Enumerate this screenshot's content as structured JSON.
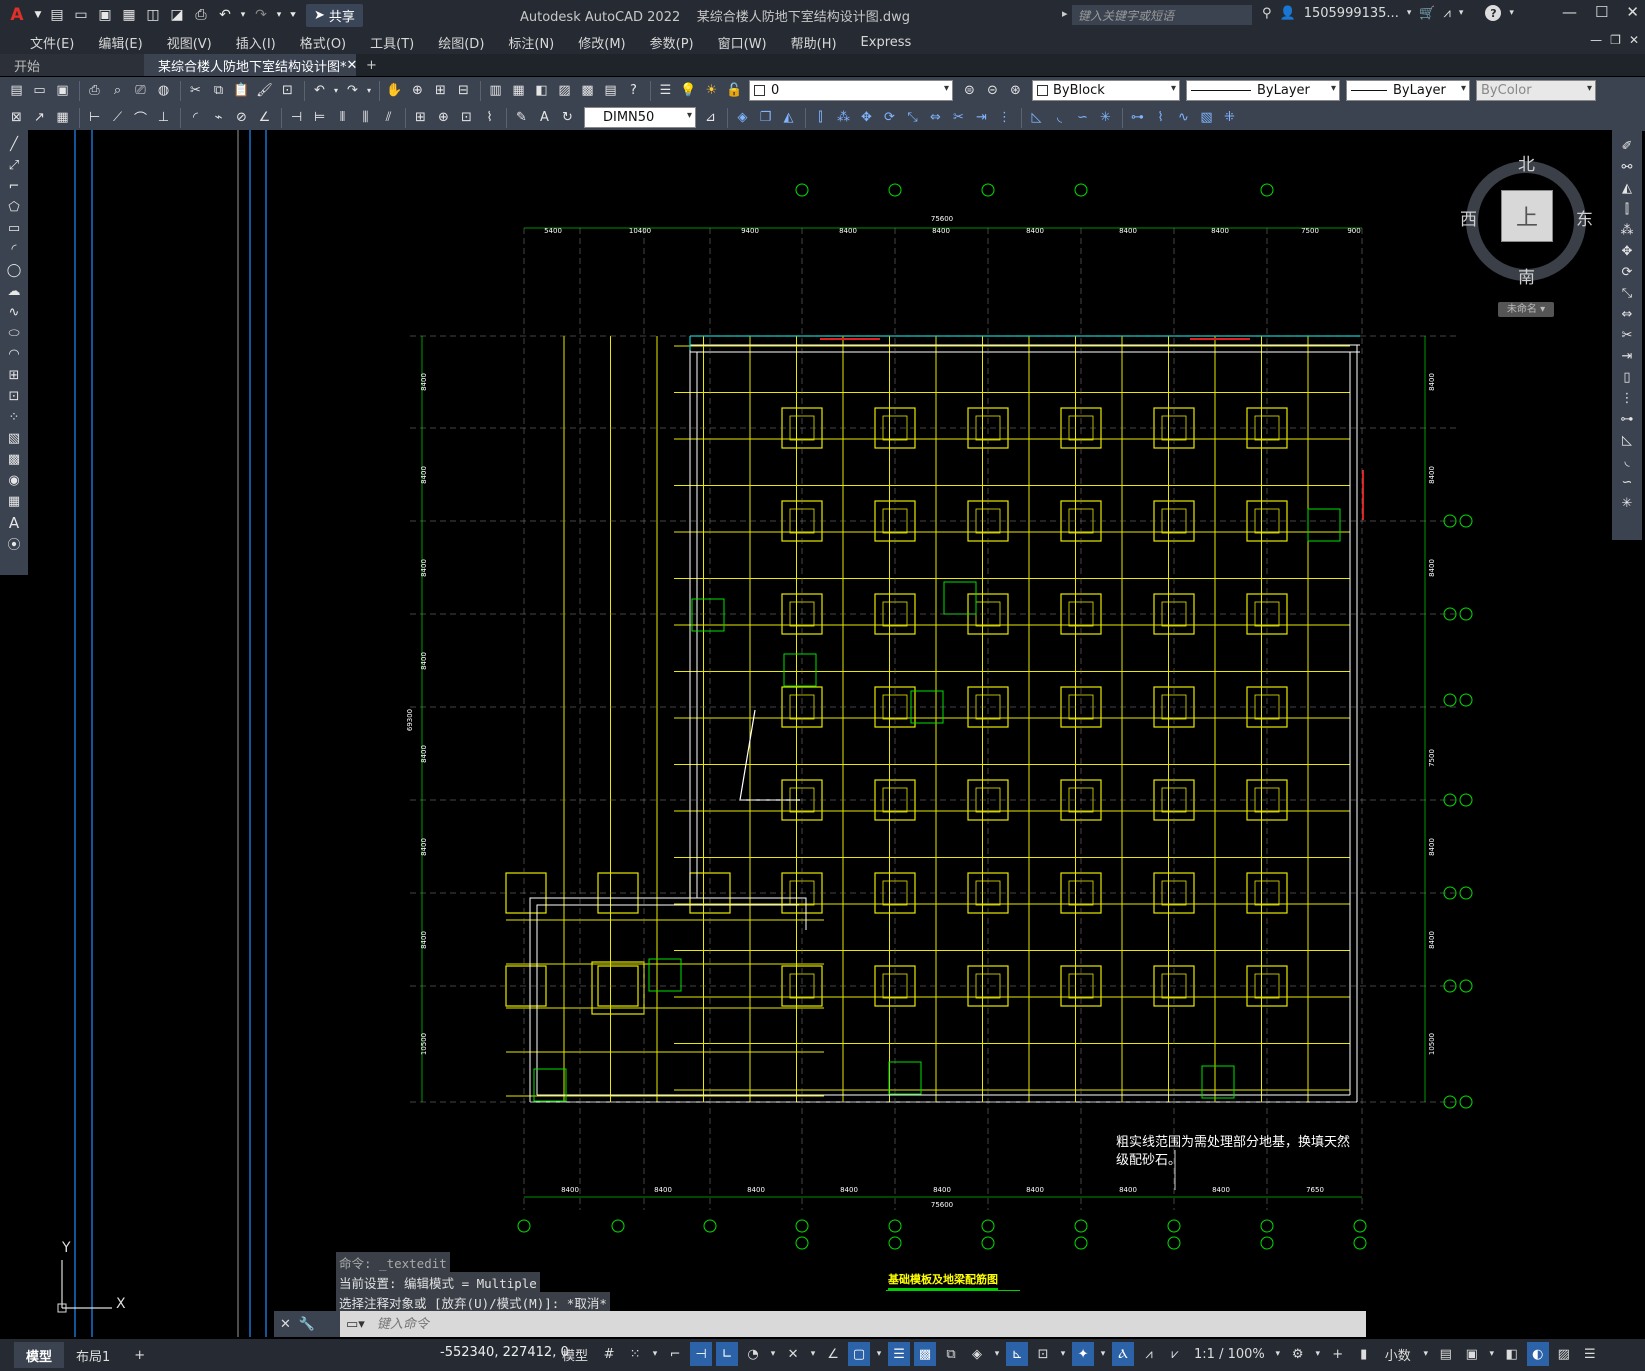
{
  "title": {
    "app": "Autodesk AutoCAD 2022",
    "file": "某综合楼人防地下室结构设计图.dwg",
    "share_label": "共享",
    "search_placeholder": "键入关键字或短语",
    "user": "1505999135...",
    "help": "?"
  },
  "menu": [
    "文件(E)",
    "编辑(E)",
    "视图(V)",
    "插入(I)",
    "格式(O)",
    "工具(T)",
    "绘图(D)",
    "标注(N)",
    "修改(M)",
    "参数(P)",
    "窗口(W)",
    "帮助(H)",
    "Express"
  ],
  "tabs": {
    "start": "开始",
    "active": "某综合楼人防地下室结构设计图*",
    "close": "✕",
    "plus": "+"
  },
  "toolbar": {
    "layer": "0",
    "color": "ByBlock",
    "linetype": "ByLayer",
    "lineweight": "ByLayer",
    "plotstyle": "ByColor",
    "dimstyle": "DIMN50"
  },
  "viewcube": {
    "north": "北",
    "south": "南",
    "east": "东",
    "west": "西",
    "face": "上",
    "wcs": "未命名 ▾"
  },
  "drawing": {
    "total_top": "75600",
    "total_bottom": "75600",
    "total_left": "69300",
    "top_dims": [
      "5400",
      "10400",
      "9400",
      "8400",
      "8400",
      "8400",
      "8400",
      "8400",
      "7500",
      "900"
    ],
    "bottom_dims": [
      "8400",
      "8400",
      "8400",
      "8400",
      "8400",
      "8400",
      "8400",
      "8400",
      "7650"
    ],
    "left_dims": [
      "8400",
      "8400",
      "8400",
      "8400",
      "8400",
      "8400",
      "8400",
      "10500"
    ],
    "right_dims": [
      "8400",
      "8400",
      "8400",
      "7500",
      "8400",
      "8400",
      "10500"
    ],
    "note_line1": "粗实线范围为需处理部分地基，换填天然",
    "note_line2": "级配砂石。",
    "drawing_title": "基础模板及地梁配筋图"
  },
  "command": {
    "history": [
      "命令: _textedit",
      "当前设置: 编辑模式 = Multiple",
      "选择注释对象或 [放弃(U)/模式(M)]: *取消*"
    ],
    "placeholder": "键入命令"
  },
  "status": {
    "model_tab": "模型",
    "layout_tab": "布局1",
    "plus": "+",
    "coords": "-552340, 227412, 0",
    "model": "模型",
    "scale": "1:1 / 100%",
    "units": "小数"
  },
  "ucs": {
    "x": "X",
    "y": "Y"
  }
}
